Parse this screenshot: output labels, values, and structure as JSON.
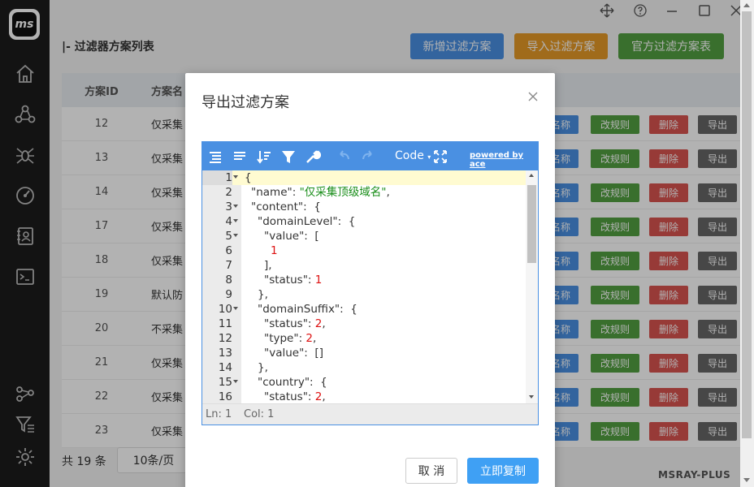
{
  "app": {
    "logo_text": "ms",
    "brand": "MSRAY-PLUS"
  },
  "page": {
    "title": "|- 过滤器方案列表",
    "buttons": {
      "add": "新增过滤方案",
      "import": "导入过滤方案",
      "official": "官方过滤方案表"
    }
  },
  "table": {
    "headers": {
      "id": "方案ID",
      "name": "方案名"
    },
    "rows": [
      {
        "id": "12",
        "name": "仅采集"
      },
      {
        "id": "13",
        "name": "仅采集"
      },
      {
        "id": "14",
        "name": "仅采集"
      },
      {
        "id": "17",
        "name": "仅采集"
      },
      {
        "id": "18",
        "name": "仅采集"
      },
      {
        "id": "19",
        "name": "默认防"
      },
      {
        "id": "20",
        "name": "不采集"
      },
      {
        "id": "21",
        "name": "仅采集"
      },
      {
        "id": "22",
        "name": "仅采集"
      },
      {
        "id": "23",
        "name": "仅采集"
      }
    ],
    "row_actions": {
      "rename": "名称",
      "edit_rules": "改规则",
      "delete": "删除",
      "export": "导出"
    }
  },
  "footer": {
    "total": "共 19 条",
    "page_size": "10条/页"
  },
  "modal": {
    "title": "导出过滤方案",
    "editor": {
      "mode_label": "Code",
      "powered_by": "powered by ace",
      "lines": [
        {
          "n": "1",
          "text": "{",
          "fold": true
        },
        {
          "n": "2",
          "key": "\"name\"",
          "str": "\"仅采集顶级域名\"",
          "tail": ","
        },
        {
          "n": "3",
          "key": "\"content\"",
          "tail": " {",
          "fold": true
        },
        {
          "n": "4",
          "key": "\"domainLevel\"",
          "tail": " {",
          "fold": true
        },
        {
          "n": "5",
          "key": "\"value\"",
          "tail": " [",
          "fold": true
        },
        {
          "n": "6",
          "num": "1"
        },
        {
          "n": "7",
          "text": "],"
        },
        {
          "n": "8",
          "key": "\"status\"",
          "num": "1"
        },
        {
          "n": "9",
          "text": "},"
        },
        {
          "n": "10",
          "key": "\"domainSuffix\"",
          "tail": " {",
          "fold": true
        },
        {
          "n": "11",
          "key": "\"status\"",
          "num": "2",
          "tail": ","
        },
        {
          "n": "12",
          "key": "\"type\"",
          "num": "2",
          "tail": ","
        },
        {
          "n": "13",
          "key": "\"value\"",
          "tail": " []"
        },
        {
          "n": "14",
          "text": "},"
        },
        {
          "n": "15",
          "key": "\"country\"",
          "tail": " {",
          "fold": true
        },
        {
          "n": "16",
          "key": "\"status\"",
          "num": "2",
          "tail": ","
        }
      ],
      "status": {
        "ln": "Ln: 1",
        "col": "Col: 1"
      }
    },
    "cancel": "取 消",
    "copy": "立即复制"
  }
}
